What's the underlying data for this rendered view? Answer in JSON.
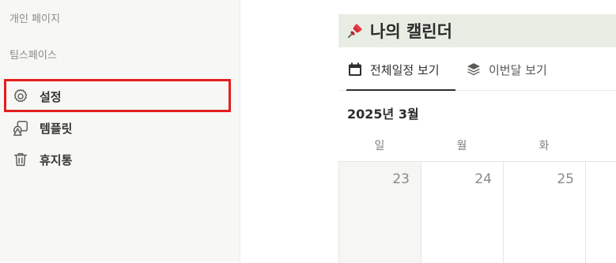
{
  "sidebar": {
    "sections": [
      "개인 페이지",
      "팀스페이스"
    ],
    "items": [
      {
        "label": "설정",
        "icon": "gear-icon"
      },
      {
        "label": "템플릿",
        "icon": "template-icon"
      },
      {
        "label": "휴지통",
        "icon": "trash-icon"
      }
    ]
  },
  "page": {
    "title": "나의 캘린더",
    "title_icon": "pushpin-icon",
    "accent": "#e8ede4"
  },
  "tabs": [
    {
      "label": "전체일정 보기",
      "icon": "calendar-icon",
      "active": true
    },
    {
      "label": "이번달 보기",
      "icon": "layers-icon",
      "active": false
    }
  ],
  "calendar": {
    "month_label": "2025년 3월",
    "weekdays": [
      "일",
      "월",
      "화"
    ],
    "days": [
      "23",
      "24",
      "25"
    ]
  },
  "colors": {
    "highlight_border": "#e41e1e",
    "sidebar_bg": "#f7f7f5"
  }
}
